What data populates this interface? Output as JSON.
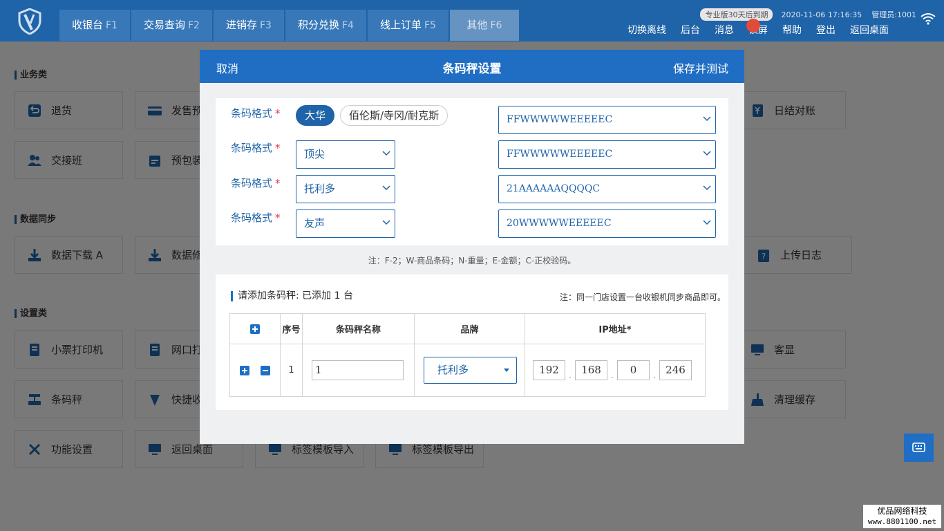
{
  "topbar": {
    "tabs": [
      {
        "label": "收银台",
        "key": "F1"
      },
      {
        "label": "交易查询",
        "key": "F2"
      },
      {
        "label": "进销存",
        "key": "F3"
      },
      {
        "label": "积分兑换",
        "key": "F4"
      },
      {
        "label": "线上订单",
        "key": "F5"
      },
      {
        "label": "其他",
        "key": "F6"
      }
    ],
    "version_badge": "专业版30天后到期",
    "datetime": "2020-11-06 17:16:35",
    "admin": "管理员:1001",
    "links": [
      "切换离线",
      "后台",
      "消息",
      "锁屏",
      "帮助",
      "登出",
      "返回桌面"
    ]
  },
  "sections": [
    {
      "title": "业务类"
    },
    {
      "title": "数据同步"
    },
    {
      "title": "设置类"
    }
  ],
  "cards": {
    "return": "退货",
    "invoice": "发售预",
    "daily_check": "日结对账",
    "shift": "交接班",
    "prepack": "预包装",
    "download": "数据下载 A",
    "data_repair": "数据修",
    "upload_log": "上传日志",
    "receipt_printer": "小票打印机",
    "net_printer": "网口打",
    "customer_display": "客显",
    "scale": "条码秤",
    "shortcut": "快捷收",
    "clear_cache": "清理缓存",
    "func_settings": "功能设置",
    "back_desktop": "返回桌面",
    "label_import": "标签模板导入",
    "label_export": "标签模板导出"
  },
  "modal": {
    "cancel": "取消",
    "title": "条码秤设置",
    "save": "保存并测试",
    "format_label": "条码格式",
    "required_mark": "*",
    "row1": {
      "option_a": "大华",
      "option_b": "佰伦斯/寺冈/耐克斯",
      "format": "FFWWWWWEEEEEC"
    },
    "row2": {
      "brand": "顶尖",
      "format": "FFWWWWWEEEEEC"
    },
    "row3": {
      "brand": "托利多",
      "format": "21AAAAAAQQQQC"
    },
    "row4": {
      "brand": "友声",
      "format": "20WWWWWEEEEEC"
    },
    "note": "注：F-2；W-商品条码；N-重量；E-金额；C-正校验码。",
    "scales_title": "请添加条码秤: 已添加 1 台",
    "scales_note": "注：同一门店设置一台收银机同步商品即可。",
    "table": {
      "headers": {
        "seq": "序号",
        "name": "条码秤名称",
        "brand": "品牌",
        "ip": "IP地址*"
      },
      "rows": [
        {
          "seq": "1",
          "name": "1",
          "brand": "托利多",
          "ip": [
            "192",
            "168",
            "0",
            "246"
          ]
        }
      ]
    }
  },
  "watermark": {
    "line1": "优品网络科技",
    "line2": "www.8801100.net"
  },
  "colors": {
    "primary": "#1f63a8",
    "modal_header": "#1f6ec4",
    "required": "#e5383b"
  }
}
